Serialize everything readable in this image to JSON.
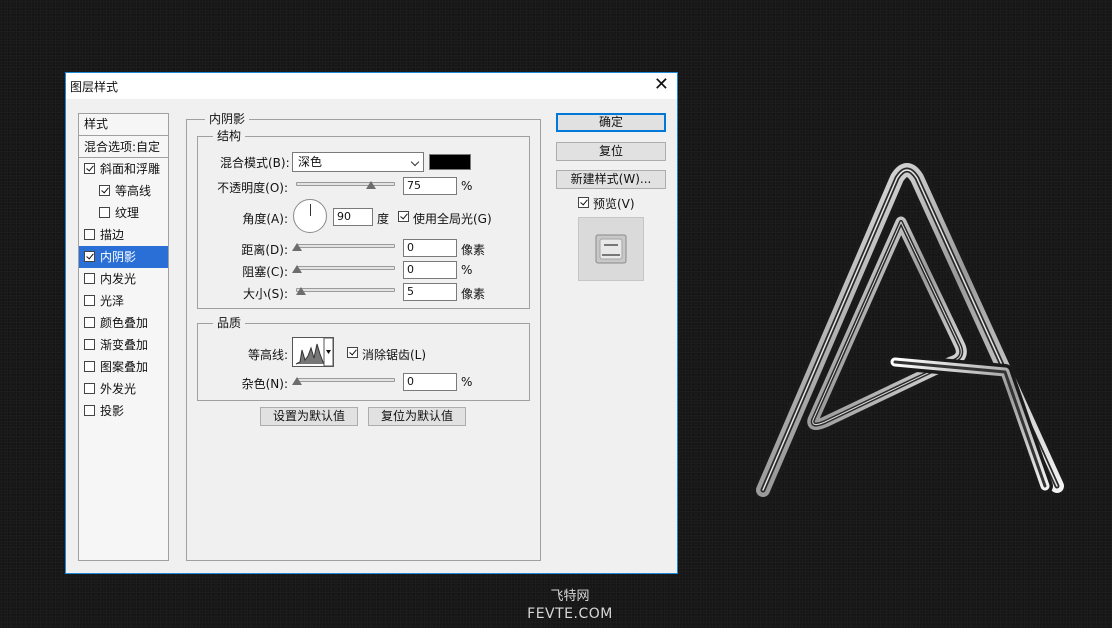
{
  "dialog": {
    "title": "图层样式",
    "close_glyph": "✕",
    "styles_panel": {
      "header": "样式",
      "blend_options": "混合选项:自定",
      "items": [
        {
          "label": "斜面和浮雕",
          "checked": true,
          "indent": false,
          "selected": false
        },
        {
          "label": "等高线",
          "checked": true,
          "indent": true,
          "selected": false
        },
        {
          "label": "纹理",
          "checked": false,
          "indent": true,
          "selected": false
        },
        {
          "label": "描边",
          "checked": false,
          "indent": false,
          "selected": false
        },
        {
          "label": "内阴影",
          "checked": true,
          "indent": false,
          "selected": true
        },
        {
          "label": "内发光",
          "checked": false,
          "indent": false,
          "selected": false
        },
        {
          "label": "光泽",
          "checked": false,
          "indent": false,
          "selected": false
        },
        {
          "label": "颜色叠加",
          "checked": false,
          "indent": false,
          "selected": false
        },
        {
          "label": "渐变叠加",
          "checked": false,
          "indent": false,
          "selected": false
        },
        {
          "label": "图案叠加",
          "checked": false,
          "indent": false,
          "selected": false
        },
        {
          "label": "外发光",
          "checked": false,
          "indent": false,
          "selected": false
        },
        {
          "label": "投影",
          "checked": false,
          "indent": false,
          "selected": false
        }
      ]
    },
    "inner_shadow": {
      "section_title": "内阴影",
      "structure": {
        "title": "结构",
        "blend_mode_label": "混合模式(B):",
        "blend_mode_value": "深色",
        "shadow_color": "#000000",
        "opacity_label": "不透明度(O):",
        "opacity_value": "75",
        "opacity_unit": "%",
        "opacity_slider": 0.75,
        "angle_label": "角度(A):",
        "angle_value": "90",
        "angle_unit": "度",
        "global_light_label": "使用全局光(G)",
        "global_light_checked": true,
        "distance_label": "距离(D):",
        "distance_value": "0",
        "distance_unit": "像素",
        "choke_label": "阻塞(C):",
        "choke_value": "0",
        "choke_unit": "%",
        "size_label": "大小(S):",
        "size_value": "5",
        "size_unit": "像素"
      },
      "quality": {
        "title": "品质",
        "contour_label": "等高线:",
        "anti_alias_label": "消除锯齿(L)",
        "anti_alias_checked": true,
        "noise_label": "杂色(N):",
        "noise_value": "0",
        "noise_unit": "%"
      },
      "make_default": "设置为默认值",
      "reset_default": "复位为默认值"
    },
    "buttons": {
      "ok": "确定",
      "reset": "复位",
      "new_style": "新建样式(W)...",
      "preview_label": "预览(V)",
      "preview_checked": true
    }
  },
  "watermark": {
    "line1": "飞特网",
    "line2": "FEVTE.COM"
  }
}
